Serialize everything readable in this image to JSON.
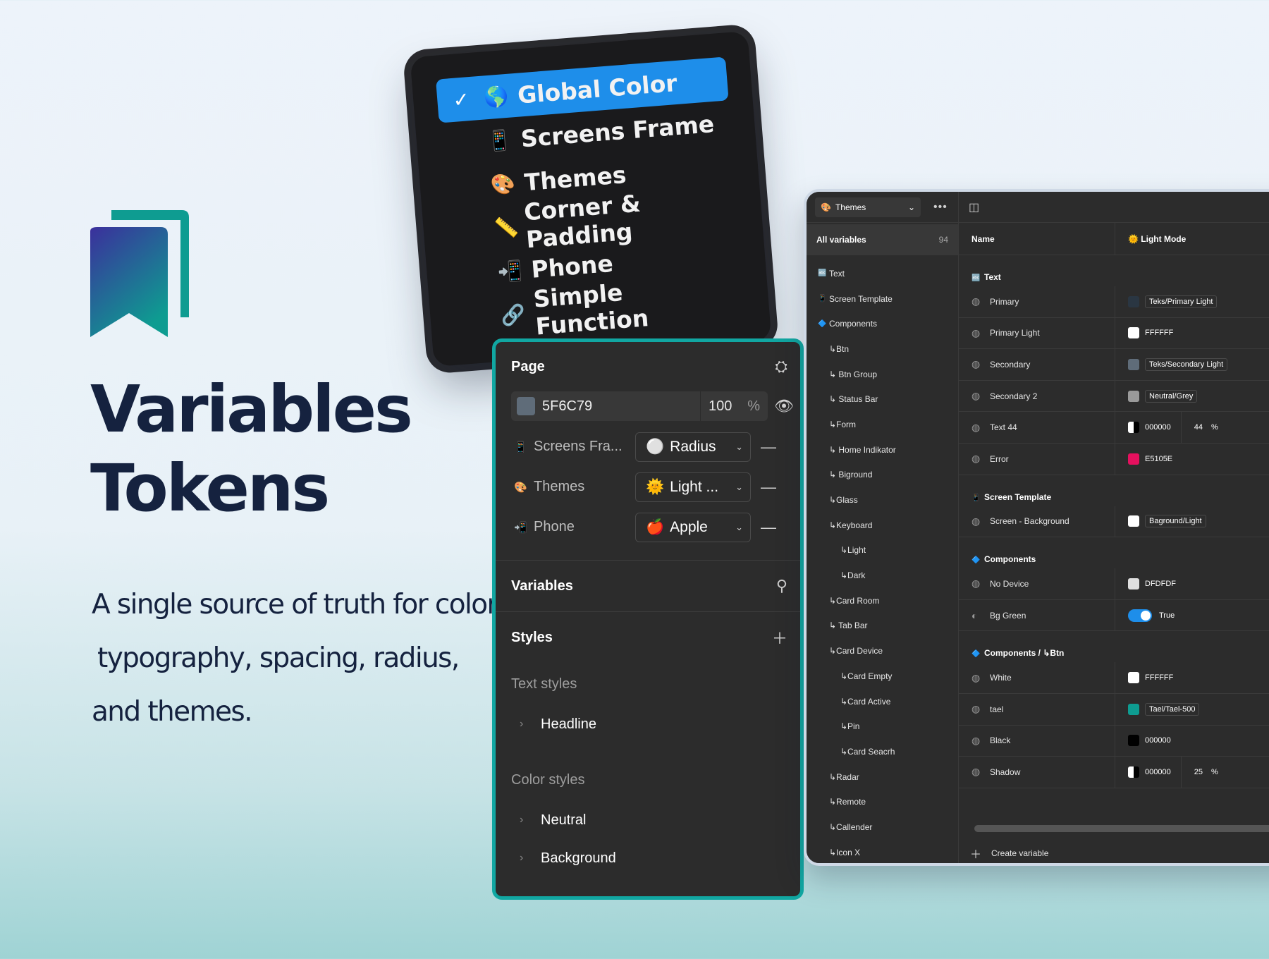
{
  "hero": {
    "title_line1": "Variables",
    "title_line2": "Tokens",
    "desc_line1": "A single source of truth for color,",
    "desc_line2": "typography, spacing, radius,",
    "desc_line3": "and themes.",
    "colors": {
      "logo_from": "#3b2f9c",
      "logo_to": "#0e9c91",
      "title": "#15223f"
    }
  },
  "menu": {
    "items": [
      {
        "label": "Global Color",
        "icon": "globe-icon",
        "emoji": "🌎",
        "selected": true
      },
      {
        "label": "Screens Frame",
        "icon": "frame-icon",
        "emoji": "📱"
      },
      {
        "label": "Themes",
        "icon": "palette-icon",
        "emoji": "🎨"
      },
      {
        "label": "Corner & Padding",
        "icon": "ruler-icon",
        "emoji": "📏"
      },
      {
        "label": "Phone",
        "icon": "phone-icon",
        "emoji": "📲"
      },
      {
        "label": "Simple Function",
        "icon": "link-icon",
        "emoji": "🔗"
      }
    ],
    "check": "✓",
    "accent": "#1e8eea"
  },
  "panel": {
    "title": "Page",
    "fill": {
      "hex": "5F6C79",
      "opacity": "100",
      "pct": "%"
    },
    "modes": [
      {
        "label": "Screens Fra...",
        "emoji": "📱",
        "value": "Radius",
        "value_emoji": "⚪"
      },
      {
        "label": "Themes",
        "emoji": "🎨",
        "value": "Light ...",
        "value_emoji": "🌞"
      },
      {
        "label": "Phone",
        "emoji": "📲",
        "value": "Apple",
        "value_emoji": "🍎"
      }
    ],
    "variables_label": "Variables",
    "styles_label": "Styles",
    "text_styles_label": "Text styles",
    "text_styles": [
      "Headline"
    ],
    "color_styles_label": "Color styles",
    "color_styles": [
      "Neutral",
      "Background"
    ],
    "border_color": "#11a7a2"
  },
  "vars": {
    "collection": "Themes",
    "all_label": "All variables",
    "all_count": "94",
    "groups": [
      {
        "label": "Text",
        "emoji": "🔤",
        "indent": 0
      },
      {
        "label": "Screen Template",
        "emoji": "📱",
        "indent": 0
      },
      {
        "label": "Components",
        "emoji": "🔷",
        "indent": 0
      },
      {
        "label": "↳Btn",
        "indent": 1
      },
      {
        "label": "↳ Btn Group",
        "indent": 1
      },
      {
        "label": "↳ Status Bar",
        "indent": 1
      },
      {
        "label": "↳Form",
        "indent": 1
      },
      {
        "label": "↳ Home Indikator",
        "indent": 1
      },
      {
        "label": "↳ Biground",
        "indent": 1
      },
      {
        "label": "↳Glass",
        "indent": 1
      },
      {
        "label": "↳Keyboard",
        "indent": 1
      },
      {
        "label": "↳Light",
        "indent": 2
      },
      {
        "label": "↳Dark",
        "indent": 2
      },
      {
        "label": "↳Card Room",
        "indent": 1
      },
      {
        "label": "↳ Tab Bar",
        "indent": 1
      },
      {
        "label": "↳Card Device",
        "indent": 1
      },
      {
        "label": "↳Card Empty",
        "indent": 2
      },
      {
        "label": "↳Card Active",
        "indent": 2
      },
      {
        "label": "↳Pin",
        "indent": 2
      },
      {
        "label": "↳Card Seacrh",
        "indent": 2
      },
      {
        "label": "↳Radar",
        "indent": 1
      },
      {
        "label": "↳Remote",
        "indent": 1
      },
      {
        "label": "↳Callender",
        "indent": 1
      },
      {
        "label": "↳Icon X",
        "indent": 1
      }
    ],
    "col_name": "Name",
    "col_mode": "Light Mode",
    "col_mode_emoji": "🌞",
    "sections": [
      {
        "title": "Text",
        "emoji": "🔤",
        "rows": [
          {
            "name": "Primary",
            "swatch": "#2a3642",
            "value": "Teks/Primary Light",
            "alias": true
          },
          {
            "name": "Primary Light",
            "swatch": "#ffffff",
            "value": "FFFFFF"
          },
          {
            "name": "Secondary",
            "swatch": "#5f6c79",
            "value": "Teks/Secondary Light",
            "alias": true
          },
          {
            "name": "Secondary 2",
            "swatch": "#9a9a9a",
            "value": "Neutral/Grey",
            "alias": true
          },
          {
            "name": "Text 44",
            "swatch": "#000000",
            "value": "000000",
            "opacity": "44",
            "pct": "%"
          },
          {
            "name": "Error",
            "swatch": "#e5105e",
            "value": "E5105E"
          }
        ]
      },
      {
        "title": "Screen Template",
        "emoji": "📱",
        "rows": [
          {
            "name": "Screen - Background",
            "swatch": "#ffffff",
            "value": "Baground/Light",
            "alias": true
          }
        ]
      },
      {
        "title": "Components",
        "emoji": "🔷",
        "rows": [
          {
            "name": "No Device",
            "swatch": "#dfdfdf",
            "value": "DFDFDF"
          },
          {
            "name": "Bg Green",
            "toggle": true,
            "value": "True"
          }
        ]
      },
      {
        "title": "Components / ↳Btn",
        "emoji": "🔷",
        "rows": [
          {
            "name": "White",
            "swatch": "#ffffff",
            "value": "FFFFFF"
          },
          {
            "name": "tael",
            "swatch": "#0e9c91",
            "value": "Tael/Tael-500",
            "alias": true
          },
          {
            "name": "Black",
            "swatch": "#000000",
            "value": "000000"
          },
          {
            "name": "Shadow",
            "swatch": "#000000",
            "value": "000000",
            "opacity": "25",
            "pct": "%"
          }
        ]
      }
    ],
    "create_label": "Create variable"
  }
}
